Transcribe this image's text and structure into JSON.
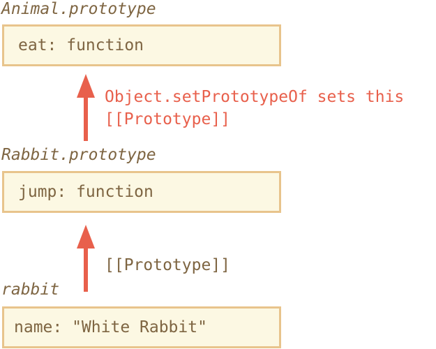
{
  "colors": {
    "text": "#7e6542",
    "box_fill": "#fcf8e3",
    "box_border": "#e8c48c",
    "arrow": "#e8604c",
    "accent_label": "#e8604c"
  },
  "objects": [
    {
      "title": "Animal.prototype",
      "property": "eat: function"
    },
    {
      "title": "Rabbit.prototype",
      "property": "jump: function"
    },
    {
      "title": "rabbit",
      "property": "name: \"White Rabbit\""
    }
  ],
  "links": [
    {
      "label_line1": "Object.setPrototypeOf sets this",
      "label_line2": "[[Prototype]]"
    },
    {
      "label": "[[Prototype]]"
    }
  ]
}
